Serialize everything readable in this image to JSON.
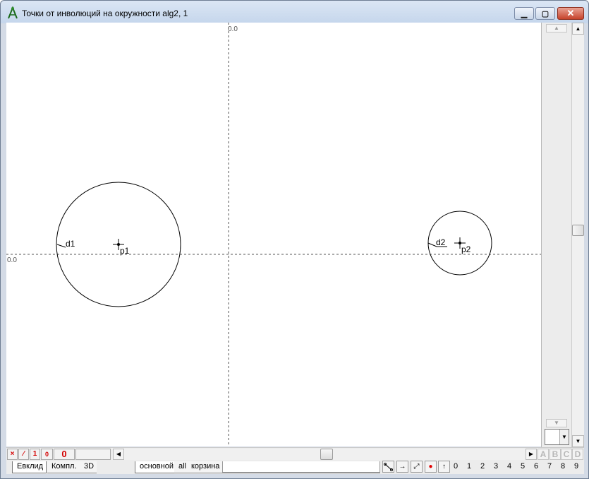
{
  "window": {
    "title": "Точки от инволюций на окружности alg2, 1",
    "minimize_label": "▁",
    "maximize_label": "▢",
    "close_label": "✕",
    "app_icon": "compass-icon"
  },
  "canvas": {
    "x_axis_origin_label": "0.0",
    "y_axis_origin_label": "0.0",
    "points": [
      {
        "name": "p1",
        "label": "p1"
      },
      {
        "name": "p2",
        "label": "p2"
      }
    ],
    "diameters": [
      {
        "name": "d1",
        "label": "d1"
      },
      {
        "name": "d2",
        "label": "d2"
      }
    ]
  },
  "toolbar_left": {
    "x_label": "×",
    "slash_label": "⁄",
    "one_label": "1",
    "zero_label": "0",
    "big_zero_label": "0"
  },
  "abcd": [
    "A",
    "B",
    "C",
    "D"
  ],
  "tabs_left": [
    "Евклид",
    "Компл.",
    "3D"
  ],
  "tabs_mid": [
    "основной",
    "all",
    "корзина"
  ],
  "tools": [
    "line-segment-icon",
    "arrow-right-icon",
    "diagonal-arrow-icon",
    "red-dot-icon",
    "up-arrow-icon"
  ],
  "numbers": [
    "0",
    "1",
    "2",
    "3",
    "4",
    "5",
    "6",
    "7",
    "8",
    "9"
  ]
}
